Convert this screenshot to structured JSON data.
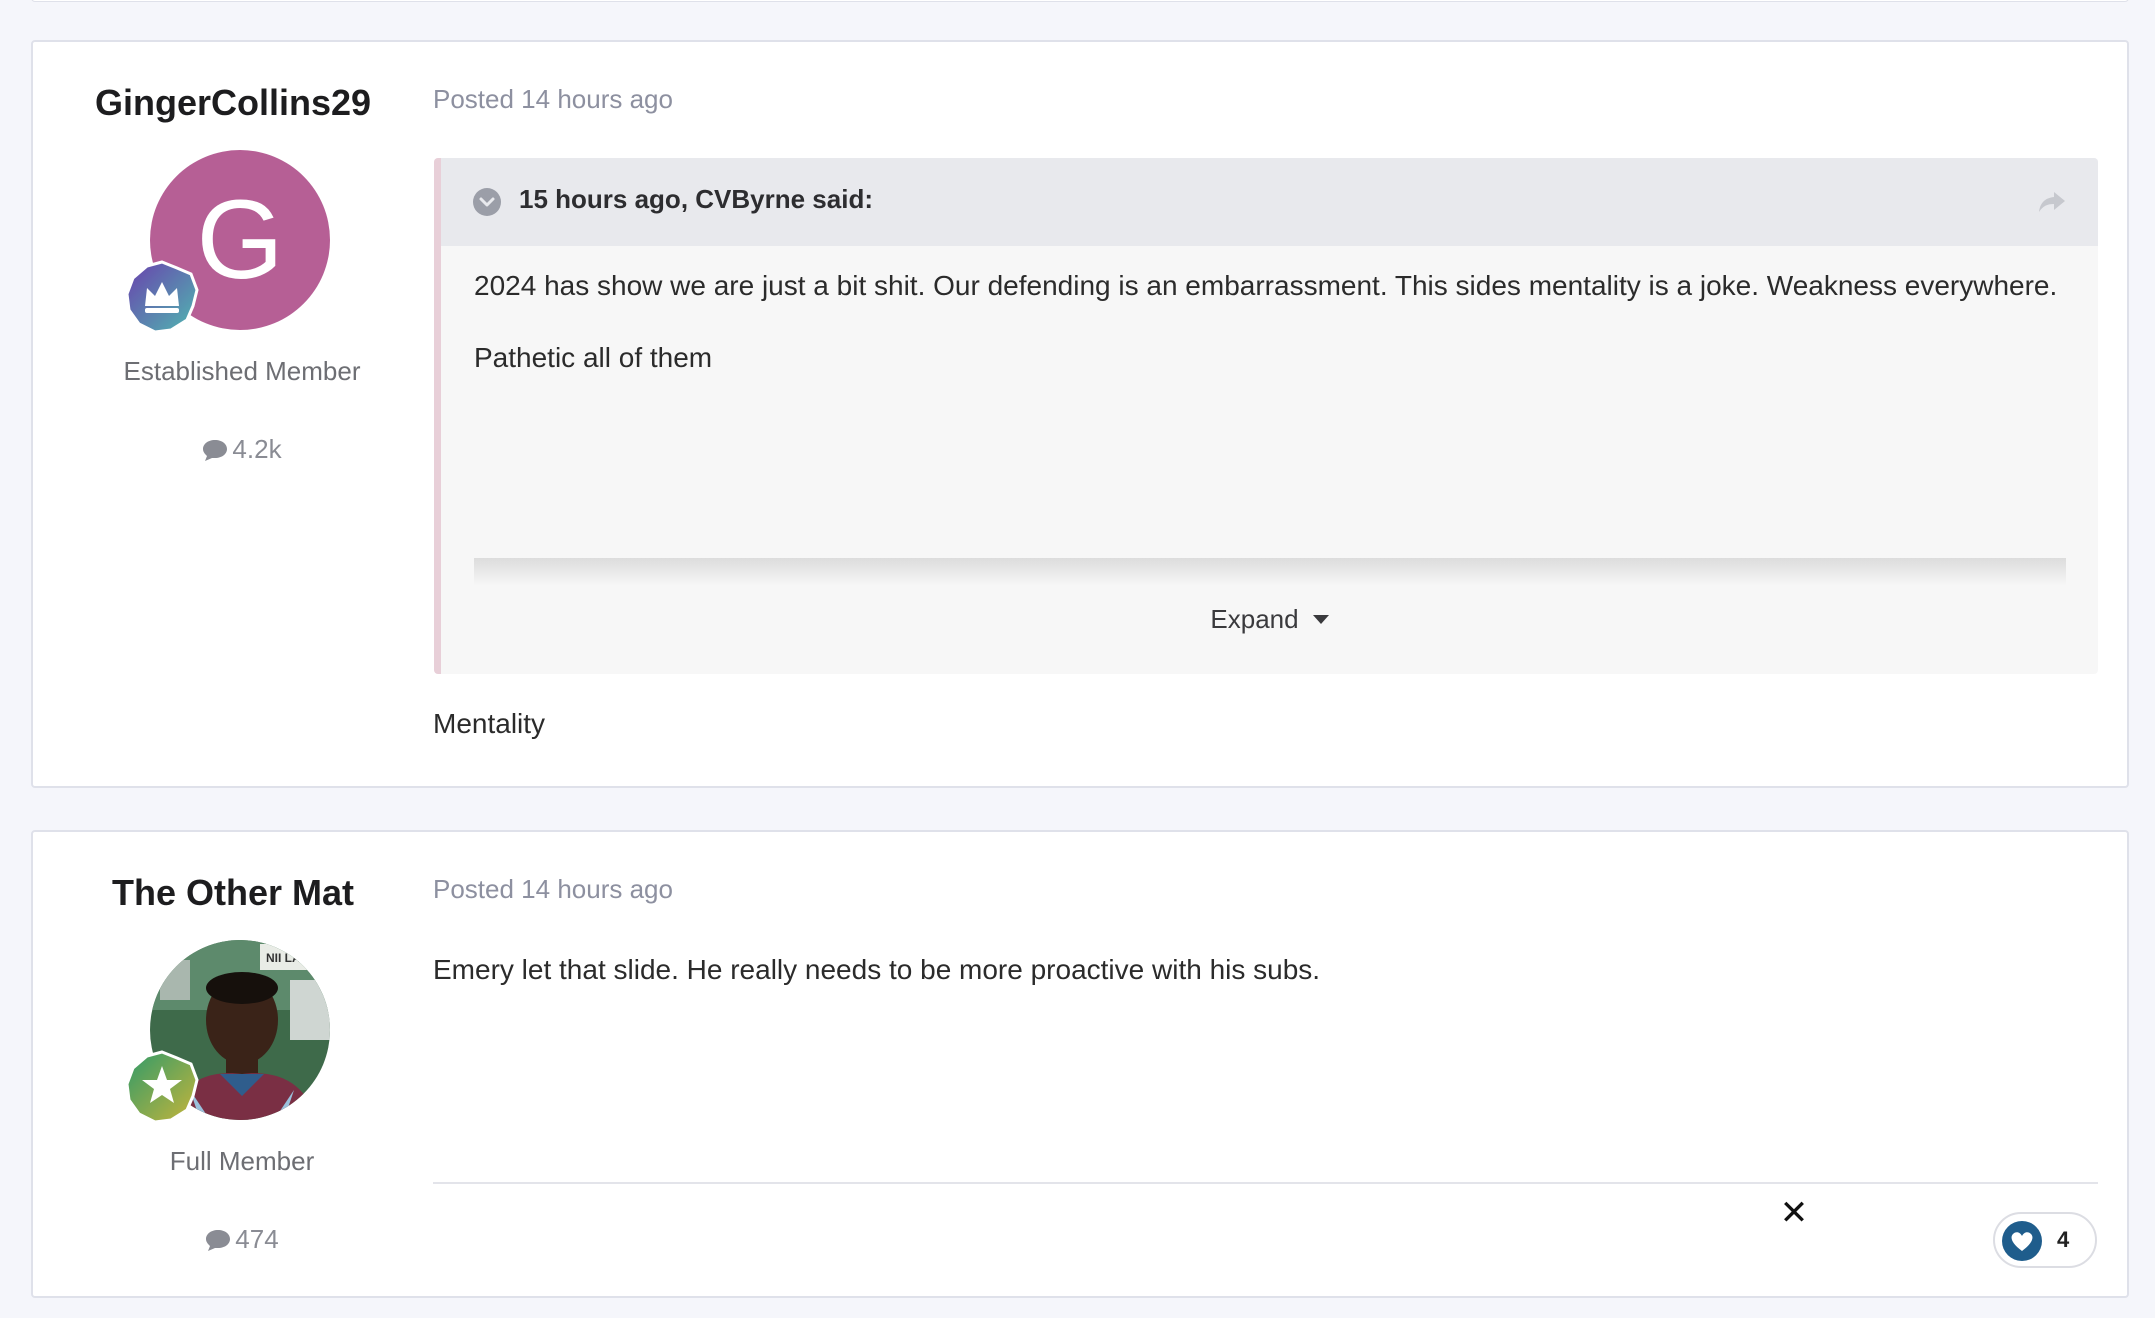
{
  "posts": [
    {
      "author": "GingerCollins29",
      "avatar_letter": "G",
      "avatar_color": "#b65f95",
      "rank_badge": "crown-badge-icon",
      "member_title": "Established Member",
      "post_count": "4.2k",
      "meta": "Posted 14 hours ago",
      "quote": {
        "cite": "15 hours ago, CVByrne said:",
        "lines": [
          "2024 has show we are just a bit shit. Our defending is an embarrassment. This sides mentality is a joke. Weakness everywhere.",
          "Pathetic all of them"
        ],
        "expand_label": "Expand"
      },
      "body": "Mentality"
    },
    {
      "author": "The Other Mat",
      "avatar_image": "player-photo",
      "rank_badge": "star-badge-icon",
      "member_title": "Full Member",
      "post_count": "474",
      "meta": "Posted 14 hours ago",
      "body": "Emery let that slide. He really needs to be more proactive with his subs.",
      "close_symbol": "✕",
      "reaction": {
        "icon": "heart-icon",
        "count": "4"
      }
    }
  ],
  "colors": {
    "accent": "#b65f95",
    "reaction": "#1f5d8c",
    "quote_border": "#e8cfd8"
  }
}
